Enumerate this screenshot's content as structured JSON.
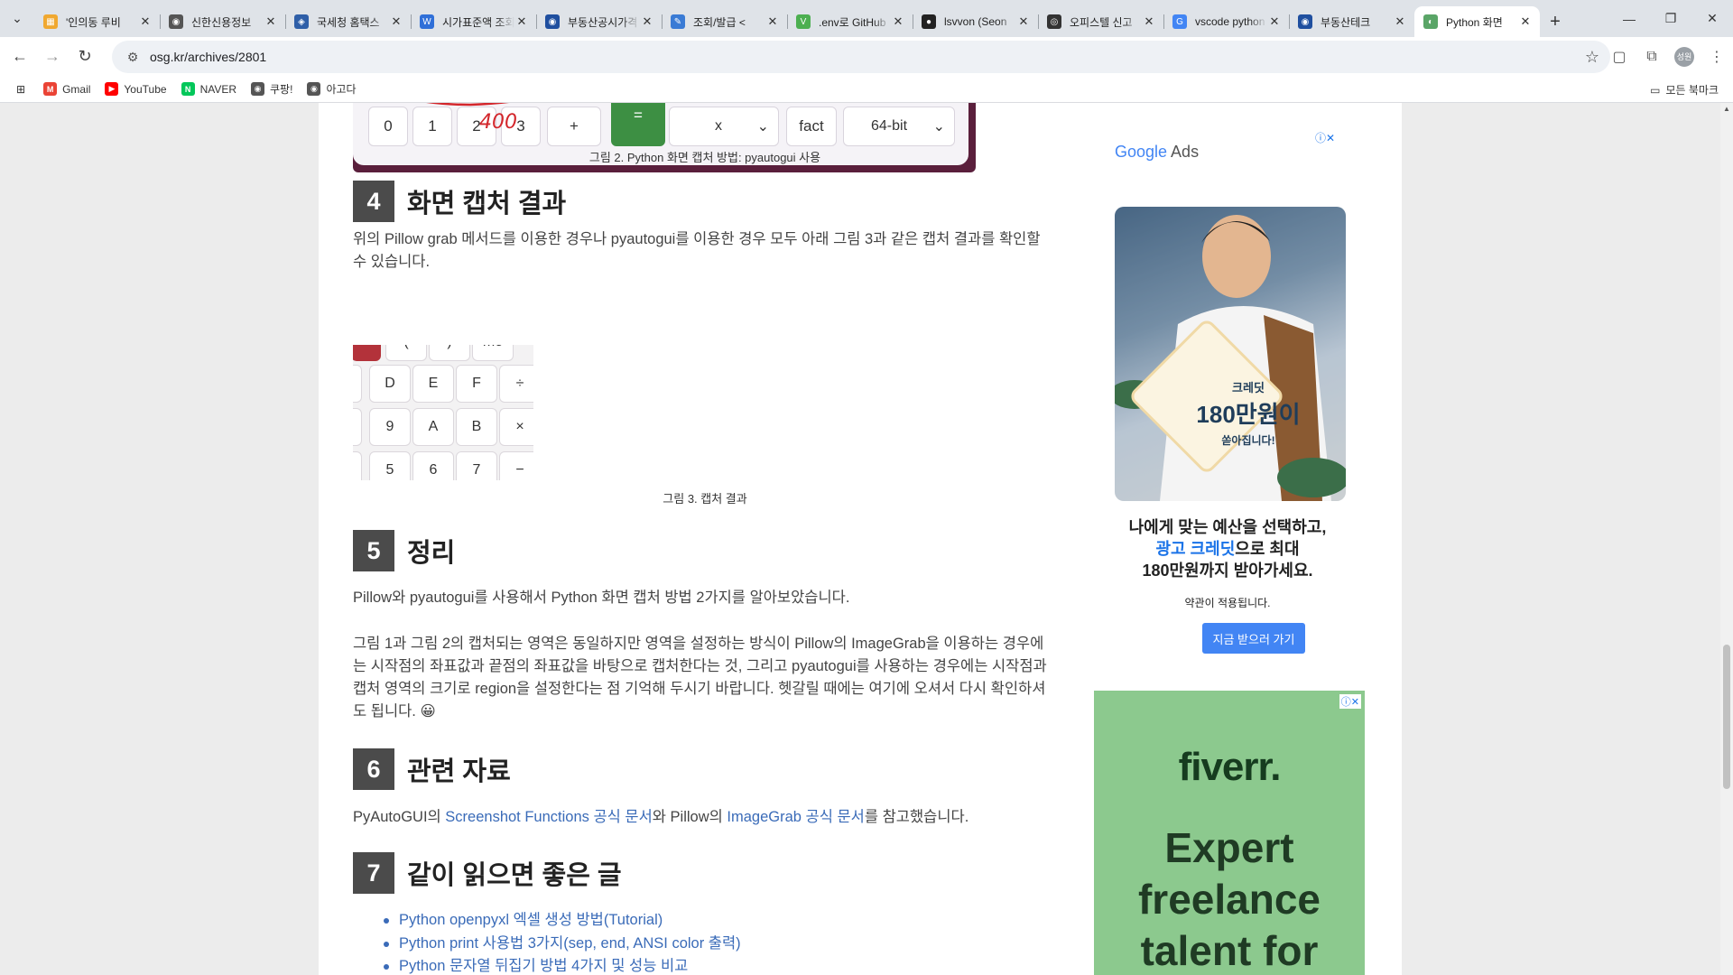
{
  "browser": {
    "tabs": [
      {
        "title": "'인의동 루비",
        "color": "#f0a830",
        "glyph": "▦",
        "active": false
      },
      {
        "title": "신한신용정보",
        "color": "#555",
        "glyph": "◉",
        "active": false
      },
      {
        "title": "국세청 홈택스",
        "color": "#2f5fa8",
        "glyph": "◈",
        "active": false
      },
      {
        "title": "시가표준액 조회",
        "color": "#2f6fd8",
        "glyph": "W",
        "active": false
      },
      {
        "title": "부동산공시가격",
        "color": "#1f4f9f",
        "glyph": "◉",
        "active": false
      },
      {
        "title": "조회/발급 <",
        "color": "#3a7bd5",
        "glyph": "✎",
        "active": false
      },
      {
        "title": ".env로 GitHub",
        "color": "#4caf50",
        "glyph": "V",
        "active": false
      },
      {
        "title": "lsvvon (Seon",
        "color": "#222",
        "glyph": "●",
        "active": false
      },
      {
        "title": "오피스텔 신고",
        "color": "#333",
        "glyph": "◎",
        "active": false
      },
      {
        "title": "vscode python",
        "color": "#4285f4",
        "glyph": "G",
        "active": false
      },
      {
        "title": "부동산테크",
        "color": "#1f4f9f",
        "glyph": "◉",
        "active": false
      },
      {
        "title": "Python 화면",
        "color": "#5aa567",
        "glyph": "◐",
        "active": true
      }
    ],
    "tab_close": "✕",
    "new_tab": "+",
    "window": {
      "minimize": "—",
      "maximize": "❐",
      "close": "✕"
    },
    "url": "osg.kr/archives/2801",
    "profile_initials": "성원",
    "bookmarks": [
      {
        "label": "Gmail",
        "color": "#ea4335",
        "glyph": "M"
      },
      {
        "label": "YouTube",
        "color": "#ff0000",
        "glyph": "▶"
      },
      {
        "label": "NAVER",
        "color": "#03c75a",
        "glyph": "N"
      },
      {
        "label": "쿠팡!",
        "color": "#555",
        "glyph": "◉"
      },
      {
        "label": "아고다",
        "color": "#555",
        "glyph": "◉"
      }
    ],
    "all_bookmarks": "모든 북마크"
  },
  "article": {
    "calc_keys": [
      "0",
      "1",
      "2",
      "3",
      "+",
      "="
    ],
    "calc_select_x": "x",
    "calc_fact": "fact",
    "calc_bits": "64-bit",
    "scribble_text": "400",
    "caption2": "그림 2. Python 화면 캡처 방법: pyautogui 사용",
    "section4": {
      "num": "4",
      "title": "화면 캡처 결과"
    },
    "section4_text": "위의 Pillow grab 메서드를 이용한 경우나 pyautogui를 이용한 경우 모두 아래 그림 3과 같은 캡처 결과를 확인할 수 있습니다.",
    "kb_rows": [
      [
        "",
        "(",
        ")",
        "mo"
      ],
      [
        "",
        "D",
        "E",
        "F",
        "÷"
      ],
      [
        "",
        "9",
        "A",
        "B",
        "×"
      ],
      [
        "",
        "5",
        "6",
        "7",
        "−"
      ]
    ],
    "caption3": "그림 3. 캡처 결과",
    "section5": {
      "num": "5",
      "title": "정리"
    },
    "section5_p1": "Pillow와 pyautogui를 사용해서 Python 화면 캡처 방법 2가지를 알아보았습니다.",
    "section5_p2": "그림 1과 그림 2의 캡처되는 영역은 동일하지만 영역을 설정하는 방식이 Pillow의 ImageGrab을 이용하는 경우에는 시작점의 좌표값과 끝점의 좌표값을 바탕으로 캡처한다는 것, 그리고 pyautogui를 사용하는 경우에는 시작점과 캡처 영역의 크기로 region을 설정한다는 점 기억해 두시기 바랍니다. 헷갈릴 때에는 여기에 오셔서 다시 확인하셔도 됩니다. 😀",
    "section6": {
      "num": "6",
      "title": "관련 자료"
    },
    "section6_pre": "PyAutoGUI의 ",
    "section6_link1": "Screenshot Functions 공식 문서",
    "section6_mid": "와 Pillow의 ",
    "section6_link2": "ImageGrab 공식 문서",
    "section6_post": "를 참고했습니다.",
    "section7": {
      "num": "7",
      "title": "같이 읽으면 좋은 글"
    },
    "related": [
      "Python openpyxl 엑셀 생성 방법(Tutorial)",
      "Python print 사용법 3가지(sep, end, ANSI color 출력)",
      "Python 문자열 뒤집기 방법 4가지 및 성능 비교"
    ]
  },
  "ads": {
    "google_ads_g": "Google",
    "google_ads_rest": " Ads",
    "ad_info_icon": "ⓘ✕",
    "badge_top": "크레딧",
    "badge_amount": "180만원이",
    "badge_bottom": "쏟아집니다!",
    "headline_1": "나에게 맞는 예산을 선택하고,",
    "headline_blue": "광고 크레딧",
    "headline_2": "으로 최대",
    "headline_3": "180만원까지 받아가세요.",
    "terms": "약관이 적용됩니다.",
    "cta": "지금 받으러 가기",
    "fiverr_logo": "fiverr.",
    "fiverr_line1": "Expert",
    "fiverr_line2": "freelance",
    "fiverr_line3": "talent for",
    "fiverr_icon": "ⓘ✕",
    "brand_blue": "#1a73e8"
  }
}
